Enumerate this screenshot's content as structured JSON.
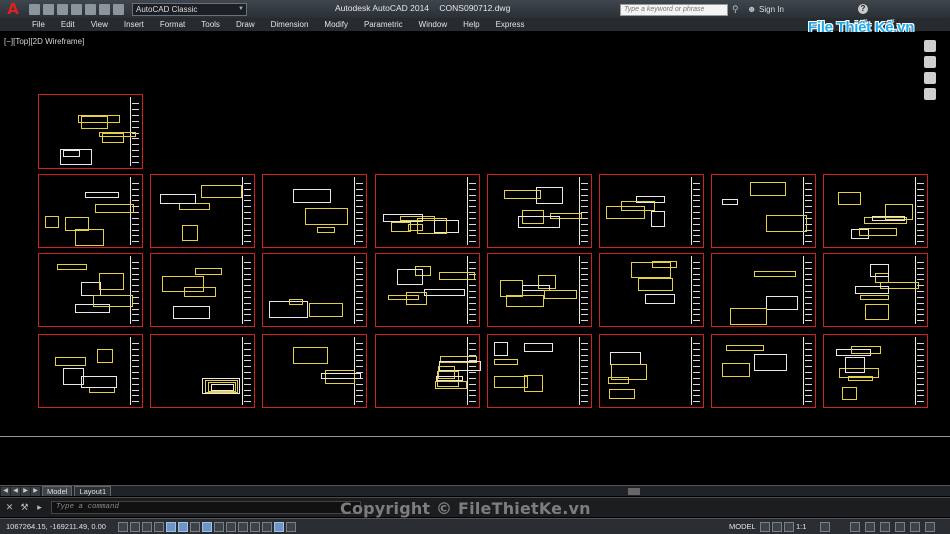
{
  "titlebar": {
    "app_name": "Autodesk AutoCAD 2014",
    "file_name": "CONS090712.dwg",
    "workspace": "AutoCAD Classic",
    "search_placeholder": "Type a keyword or phrase",
    "sign_in": "Sign In",
    "help": "?"
  },
  "menu": [
    "File",
    "Edit",
    "View",
    "Insert",
    "Format",
    "Tools",
    "Draw",
    "Dimension",
    "Modify",
    "Parametric",
    "Window",
    "Help",
    "Express"
  ],
  "viewport": {
    "label": "[−][Top][2D Wireframe]"
  },
  "watermark": {
    "logo": "File Thiết Kế.vn",
    "copyright": "Copyright © FileThietKe.vn"
  },
  "layout_tabs": [
    "Model",
    "Layout1"
  ],
  "command": {
    "placeholder": "Type a command"
  },
  "status": {
    "coordinates": "1067264.15, -169211.49, 0.00",
    "model": "MODEL",
    "scale": "1:1"
  },
  "colors": {
    "sheet_border": "#d02020",
    "plan_lines": "#e4d040",
    "title_bar": "#2b3036",
    "background": "#000000"
  },
  "icons": {
    "app_logo": "autocad-a-icon",
    "search": "binoculars-icon",
    "user": "user-icon",
    "help": "help-icon"
  }
}
